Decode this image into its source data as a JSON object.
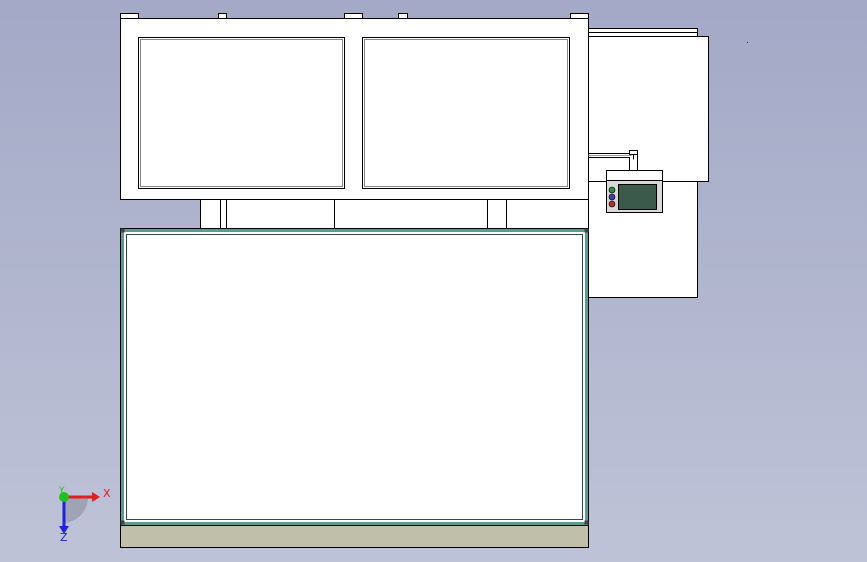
{
  "viewport": {
    "background_top": "#a3a9c6",
    "background_bottom": "#bfc3d8"
  },
  "model": {
    "line_color": "#000000",
    "panel_fill": "#ffffff",
    "guard_frame_color": "#5d9a91",
    "base_color": "#c0bfaa",
    "hmi_screen_color": "#3c5a4c",
    "indicator_colors": [
      "#2f8a3a",
      "#3c3cb0",
      "#b03030"
    ]
  },
  "triad": {
    "x_label": "X",
    "y_label": "Y",
    "z_label": "Z",
    "x_color": "#e02020",
    "y_color": "#20c020",
    "z_color": "#2020e0"
  }
}
